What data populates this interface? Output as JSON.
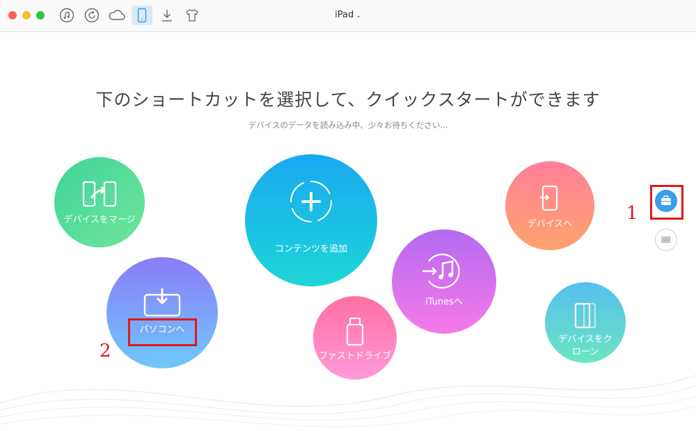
{
  "window": {
    "device_selector": "iPad"
  },
  "toolbar": {
    "icons": [
      "music-icon",
      "restore-icon",
      "cloud-icon",
      "device-icon",
      "download-icon",
      "tshirt-icon"
    ],
    "active": "device-icon"
  },
  "main": {
    "headline": "下のショートカットを選択して、クイックスタートができます",
    "subline": "デバイスのデータを読み込み中、少々お待ちください..."
  },
  "shortcuts": {
    "merge": "デバイスをマージ",
    "add_content": "コンテンツを追加",
    "to_device": "デバイスへ",
    "to_pc": "パソコンへ",
    "itunes": "iTunesへ",
    "fast_drive": "ファストドライブ",
    "clone_line1": "デバイスをク",
    "clone_line2": "ローン"
  },
  "annotations": {
    "one": "1",
    "two": "2"
  },
  "colors": {
    "accent": "#3a9ee8",
    "callout": "#e01919"
  }
}
